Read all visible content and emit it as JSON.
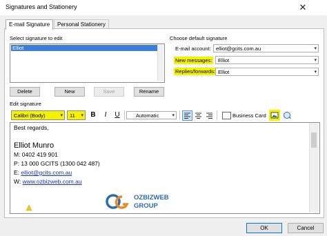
{
  "window": {
    "title": "Signatures and Stationery",
    "close_glyph": "✕"
  },
  "tabs": [
    {
      "label": "E-mail Signature",
      "active": true
    },
    {
      "label": "Personal Stationery",
      "active": false
    }
  ],
  "select_signature": {
    "label": "Select signature to edit",
    "items": [
      "Elliot"
    ],
    "selected": "Elliot"
  },
  "list_buttons": {
    "delete": "Delete",
    "new": "New",
    "save": "Save",
    "rename": "Rename"
  },
  "default_signature": {
    "group_label": "Choose default signature",
    "account_label": "E-mail account:",
    "account_value": "elliot@gcits.com.au",
    "new_messages_label": "New messages:",
    "new_messages_value": "Elliot",
    "replies_label": "Replies/forwards:",
    "replies_value": "Elliot"
  },
  "edit_signature": {
    "label": "Edit signature",
    "font_name": "Calibri (Body)",
    "font_size": "11",
    "bold": "B",
    "italic": "I",
    "underline": "U",
    "color_value": "Automatic",
    "business_card_label": "Business Card"
  },
  "signature_content": {
    "greeting": "Best regards,",
    "name": "Elliot Munro",
    "mobile": "M: 0402 419 901",
    "phone": "P: 13 000 GCITS (1300 042 487)",
    "email_prefix": "E: ",
    "email": "elliot@gcits.com.au",
    "web_prefix": "W: ",
    "web": "www.ozbizweb.com.au",
    "logo_line1": "OZBIZWEB",
    "logo_line2": "GROUP"
  },
  "footer": {
    "ok": "OK",
    "cancel": "Cancel"
  },
  "colors": {
    "highlight": "#f5f200",
    "selection": "#3d7fd6",
    "link": "#1a35b8",
    "logo_blue": "#2b6cb0",
    "logo_orange": "#e8892b"
  }
}
